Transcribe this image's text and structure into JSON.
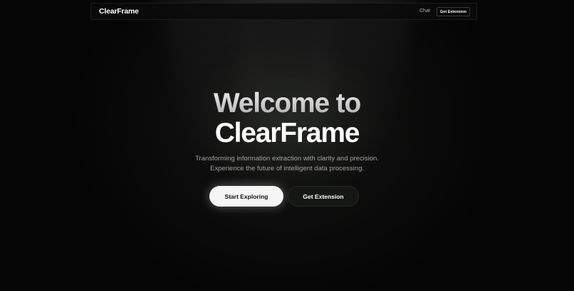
{
  "nav": {
    "logo": "ClearFrame",
    "chat_label": "Chat",
    "extension_label": "Get Extension"
  },
  "hero": {
    "title_line1": "Welcome to",
    "title_line2": "ClearFrame",
    "subtitle_line1": "Transforming information extraction with clarity and precision.",
    "subtitle_line2": "Experience the future of intelligent data processing.",
    "primary_button": "Start Exploring",
    "secondary_button": "Get Extension"
  },
  "colors": {
    "background": "#050505",
    "primary_button_bg": "#f5f5f5",
    "secondary_button_bg": "#141714"
  }
}
